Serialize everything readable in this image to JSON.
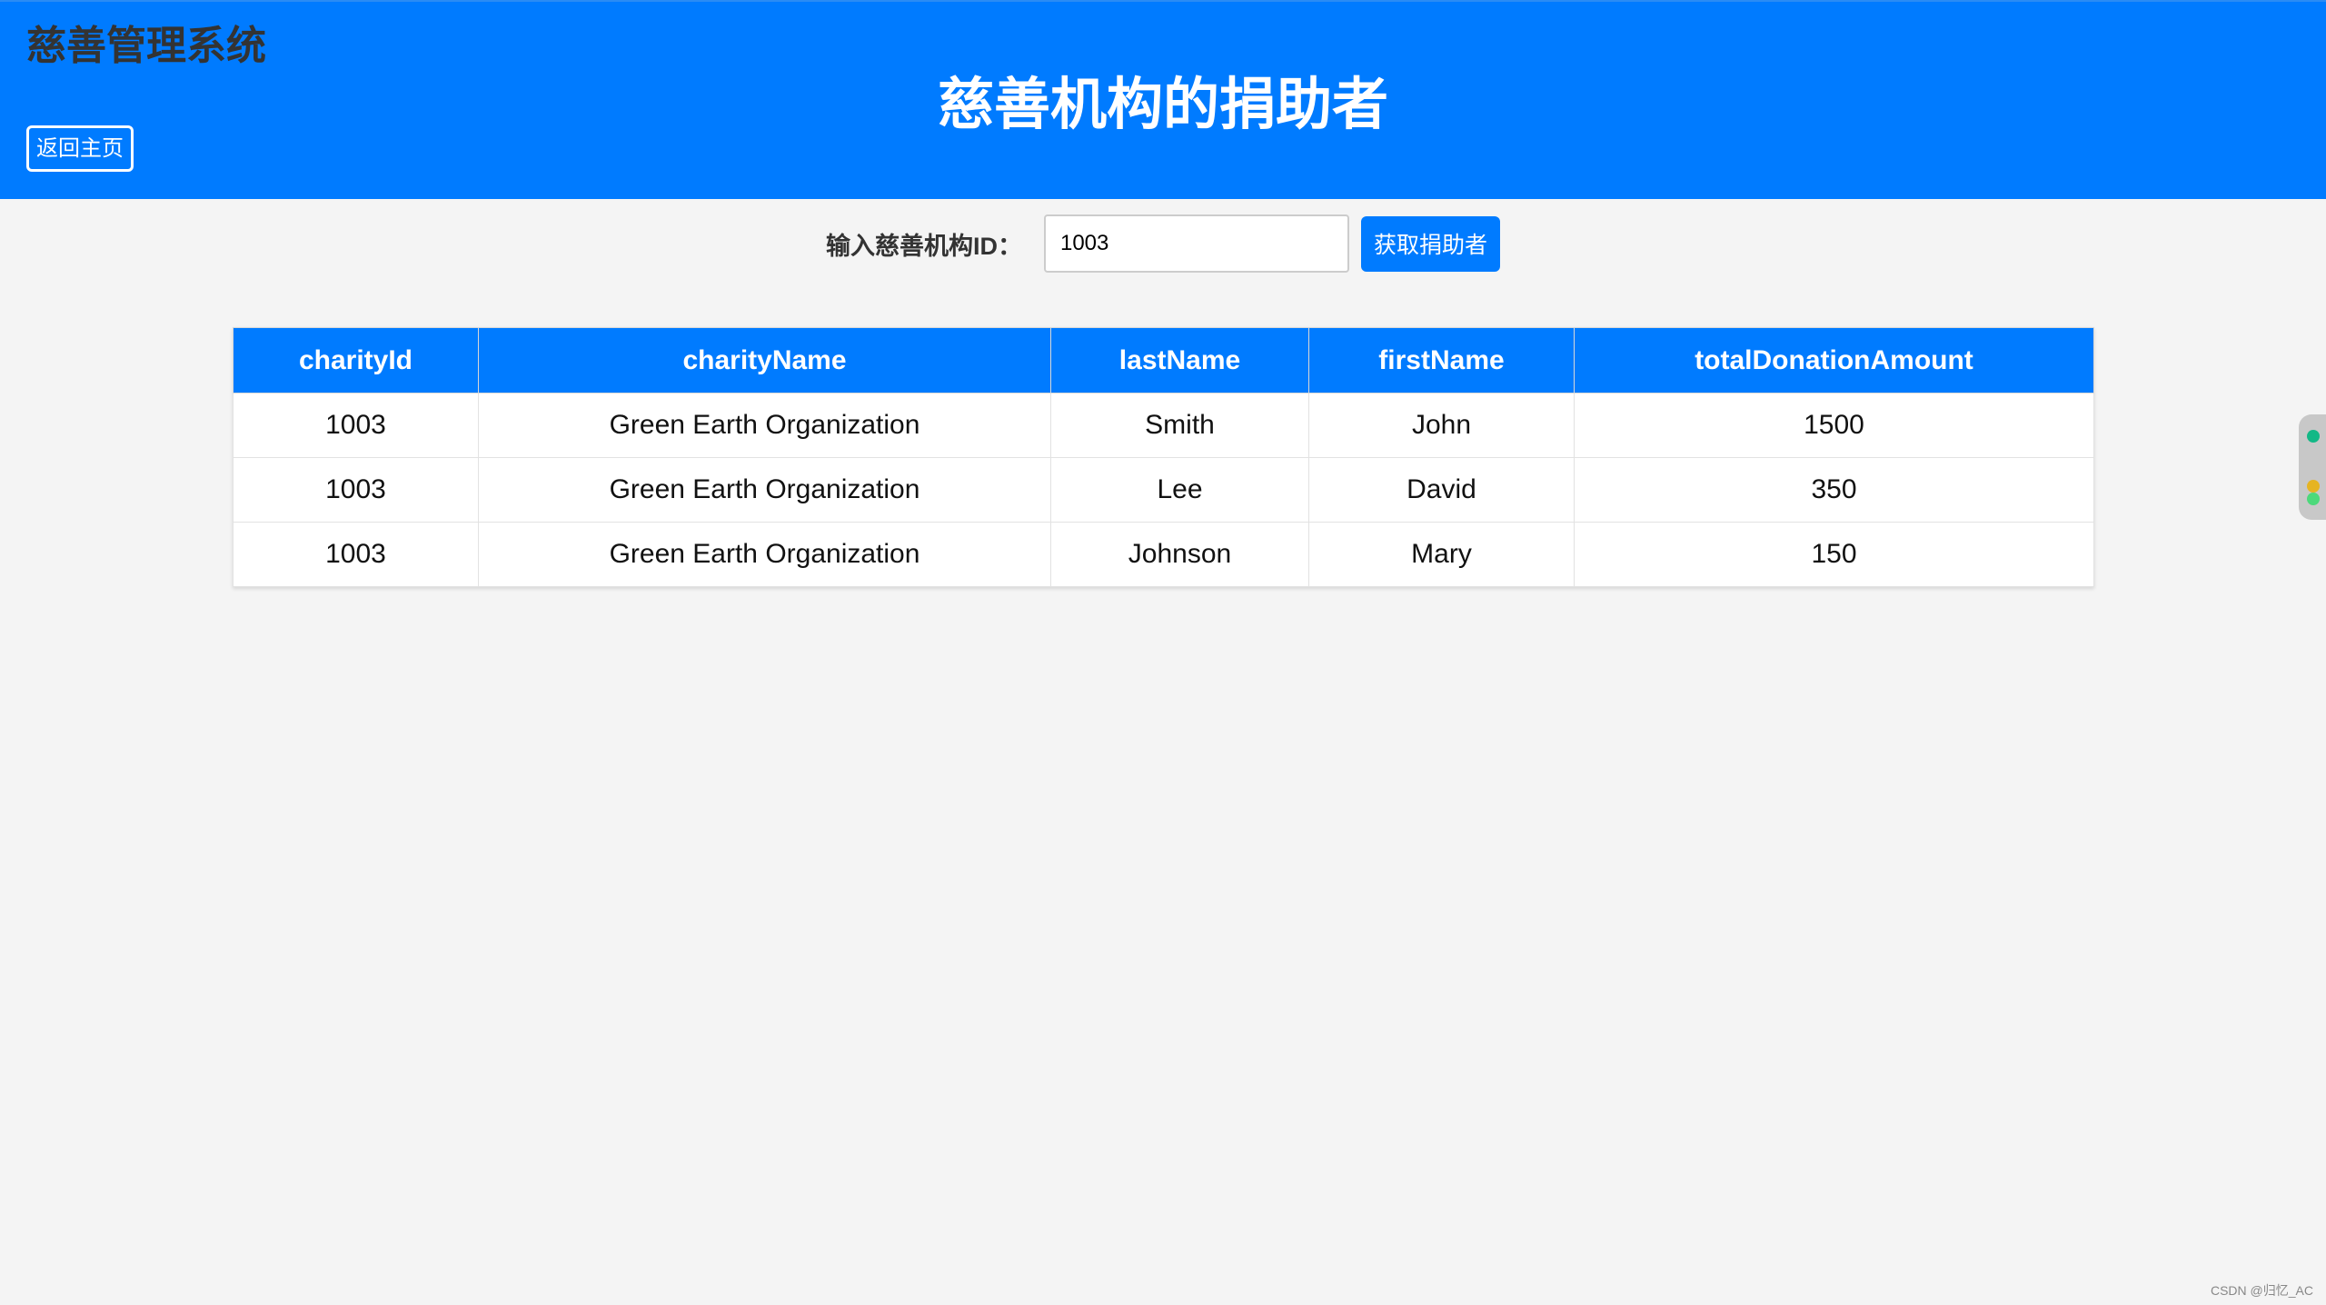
{
  "header": {
    "app_title": "慈善管理系统",
    "page_heading": "慈善机构的捐助者",
    "home_button_label": "返回主页"
  },
  "search": {
    "label": "输入慈善机构ID：",
    "input_value": "1003",
    "button_label": "获取捐助者"
  },
  "table": {
    "columns": [
      "charityId",
      "charityName",
      "lastName",
      "firstName",
      "totalDonationAmount"
    ],
    "rows": [
      [
        "1003",
        "Green Earth Organization",
        "Smith",
        "John",
        "1500"
      ],
      [
        "1003",
        "Green Earth Organization",
        "Lee",
        "David",
        "350"
      ],
      [
        "1003",
        "Green Earth Organization",
        "Johnson",
        "Mary",
        "150"
      ]
    ]
  },
  "watermark": "CSDN @归忆_AC",
  "colors": {
    "primary": "#007bff",
    "background": "#f4f4f4",
    "app_title_text": "#333333",
    "side_widget_top": "#12b886",
    "side_widget_mid": "#e6b422",
    "side_widget_bottom": "#4cd97b"
  }
}
